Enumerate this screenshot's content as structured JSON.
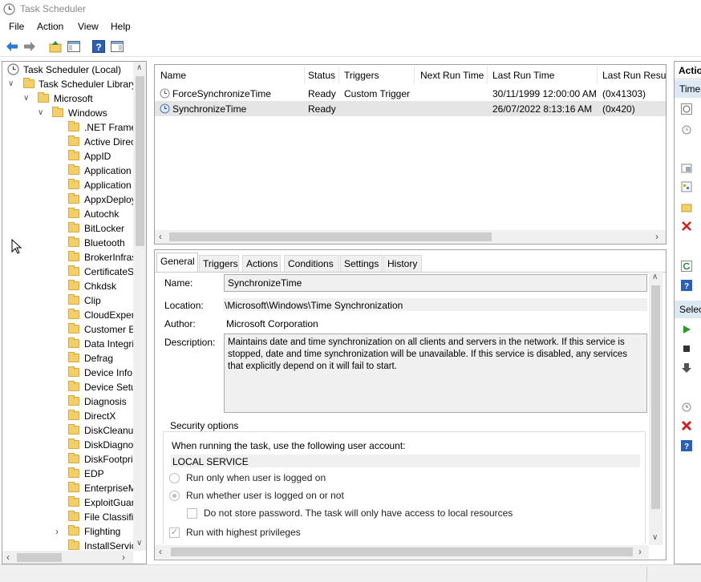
{
  "window": {
    "title": "Task Scheduler"
  },
  "menu": [
    "File",
    "Action",
    "View",
    "Help"
  ],
  "tree": {
    "root": "Task Scheduler (Local)",
    "library": "Task Scheduler Library",
    "microsoft": "Microsoft",
    "windows": "Windows",
    "folders": [
      ".NET Frame",
      "Active Direc",
      "AppID",
      "Application",
      "Application",
      "AppxDeploy",
      "Autochk",
      "BitLocker",
      "Bluetooth",
      "BrokerInfras",
      "CertificateS",
      "Chkdsk",
      "Clip",
      "CloudExper",
      "Customer E",
      "Data Integri",
      "Defrag",
      "Device Info",
      "Device Setu",
      "Diagnosis",
      "DirectX",
      "DiskCleanu",
      "DiskDiagno",
      "DiskFootpri",
      "EDP",
      "EnterpriseM",
      "ExploitGuar",
      "File Classifi",
      "Flighting",
      "InstallServic"
    ]
  },
  "task_list": {
    "columns": [
      "Name",
      "Status",
      "Triggers",
      "Next Run Time",
      "Last Run Time",
      "Last Run Result"
    ],
    "rows": [
      {
        "name": "ForceSynchronizeTime",
        "status": "Ready",
        "triggers": "Custom Trigger",
        "next_run": "",
        "last_run": "30/11/1999 12:00:00 AM",
        "result": "(0x41303)"
      },
      {
        "name": "SynchronizeTime",
        "status": "Ready",
        "triggers": "",
        "next_run": "",
        "last_run": "26/07/2022 8:13:16 AM",
        "result": "(0x420)"
      }
    ]
  },
  "details": {
    "tabs": [
      "General",
      "Triggers",
      "Actions",
      "Conditions",
      "Settings",
      "History"
    ],
    "name_label": "Name:",
    "name_value": "SynchronizeTime",
    "location_label": "Location:",
    "location_value": "\\Microsoft\\Windows\\Time Synchronization",
    "author_label": "Author:",
    "author_value": "Microsoft Corporation",
    "description_label": "Description:",
    "description_value": "Maintains date and time synchronization on all clients and servers in the network. If this service is stopped, date and time synchronization will be unavailable. If this service is disabled, any services that explicitly depend on it will fail to start.",
    "security": {
      "title": "Security options",
      "account_prompt": "When running the task, use the following user account:",
      "account": "LOCAL SERVICE",
      "opt_logged_on": "Run only when user is logged on",
      "opt_whether": "Run whether user is logged on or not",
      "opt_no_password": "Do not store password.  The task will only have access to local resources",
      "opt_highest": "Run with highest privileges"
    }
  },
  "actions": {
    "header1": "Actio",
    "sub1": "Time",
    "header2": "Selec"
  },
  "colors": {
    "selection": "#cce8ff",
    "accent": "#0078d7",
    "pane_border": "#a0a0a0"
  }
}
